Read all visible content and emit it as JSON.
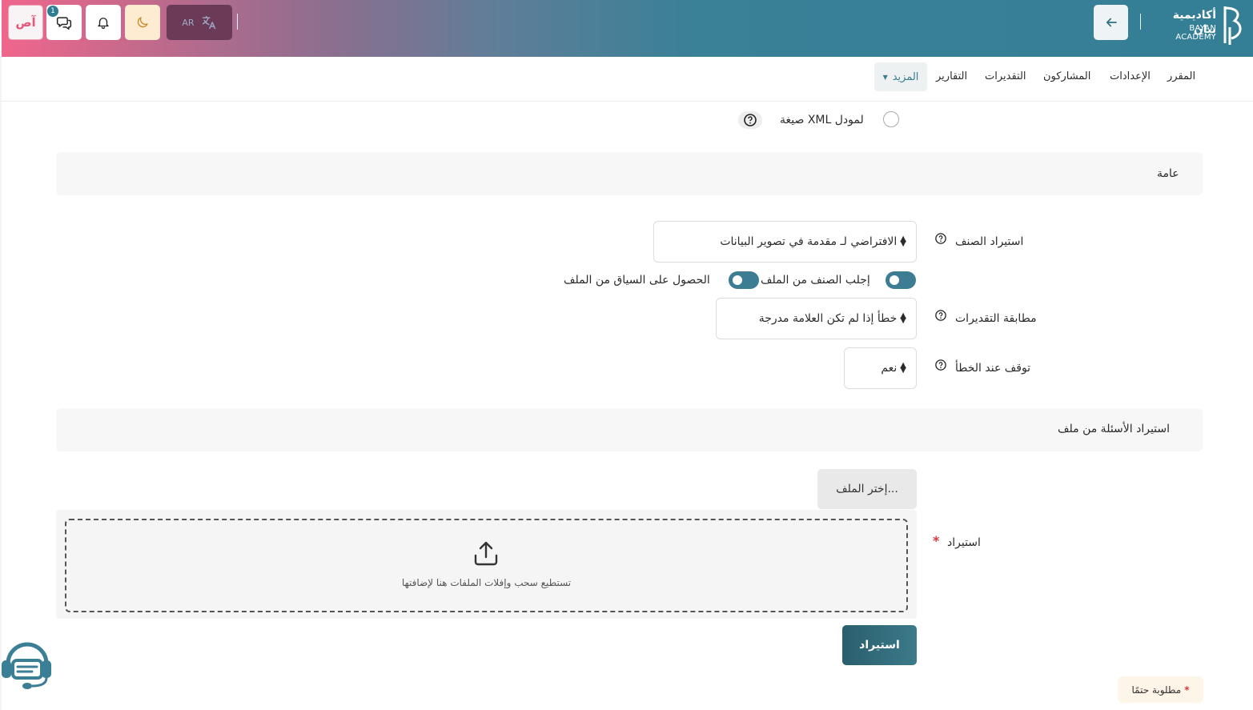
{
  "header": {
    "user_initials": "آص",
    "message_count": "1",
    "lang_code": "AR",
    "logo_arabic": "أكاديمية بيان",
    "logo_english": "BAYAN ACADEMY"
  },
  "nav": {
    "items": [
      "المقرر",
      "الإعدادات",
      "المشاركون",
      "التقديرات",
      "التقارير"
    ],
    "more_label": "المزيد"
  },
  "format_option": {
    "label": "صيغة XML لمودل"
  },
  "sections": {
    "general": "عامة",
    "import_from_file": "استيراد الأسئلة من ملف"
  },
  "form": {
    "import_category_label": "استيراد الصنف",
    "import_category_value": "الافتراضي لـ مقدمة في تصوير البيانات",
    "toggle_category_from_file": "إجلب الصنف من الملف",
    "toggle_context_from_file": "الحصول على السياق من الملف",
    "grade_matching_label": "مطابقة التقديرات",
    "grade_matching_value": "خطأ إذا لم تكن العلامة مدرجة",
    "stop_on_error_label": "توقف عند الخطأ",
    "stop_on_error_value": "نعم",
    "import_label": "استيراد",
    "choose_file_label": "إختر الملف...",
    "dropzone_text": "تستطيع سحب وإفلات الملفات هنا لإضافتها",
    "submit_label": "استيراد",
    "required_note": "مطلوبة حتمًا"
  },
  "colors": {
    "primary": "#347f96",
    "accent_pink": "#f0668c",
    "required": "#d9363e"
  }
}
